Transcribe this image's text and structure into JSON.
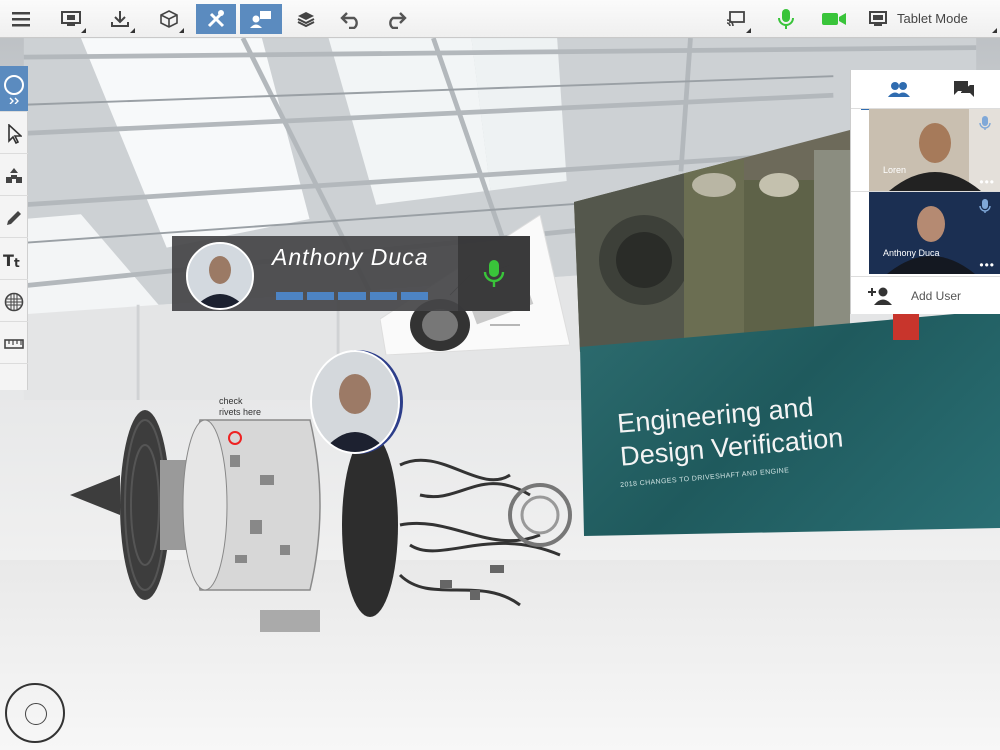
{
  "toolbar": {
    "mode_label": "Tablet Mode",
    "icons": [
      "menu-icon",
      "screen-share-icon",
      "download-icon",
      "cube-icon",
      "tools-icon",
      "presenter-icon",
      "layers-icon",
      "undo-icon",
      "redo-icon",
      "cast-icon",
      "microphone-icon",
      "video-camera-icon",
      "tablet-icon"
    ],
    "accent_color": "#5b8bbf",
    "status_color": "#39c43a"
  },
  "rail": {
    "icons": [
      "navigate-icon",
      "pointer-icon",
      "explode-icon",
      "pencil-icon",
      "text-icon",
      "material-icon",
      "ruler-icon"
    ]
  },
  "speaker": {
    "name": "Anthony Duca",
    "meter_level": 1.0
  },
  "participants": {
    "tiles": [
      {
        "name": "Loren"
      },
      {
        "name": "Anthony Duca"
      }
    ],
    "add_user_label": "Add User"
  },
  "slide": {
    "title_line1": "Engineering and",
    "title_line2": "Design Verification",
    "subtitle": "2018 CHANGES TO DRIVESHAFT AND ENGINE"
  },
  "annotation": {
    "line1": "check",
    "line2": "rivets here"
  }
}
